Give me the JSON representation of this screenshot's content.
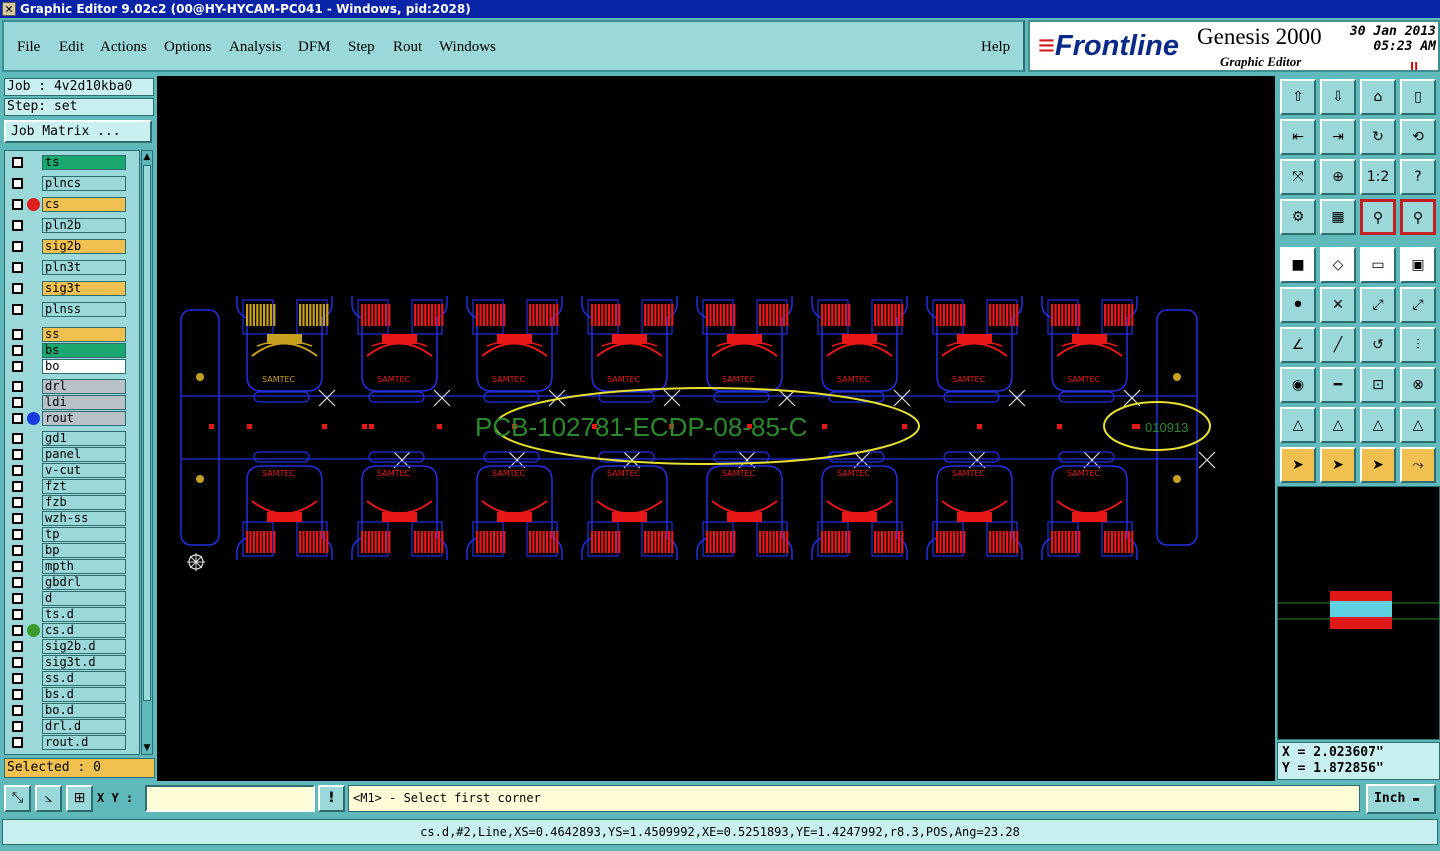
{
  "window": {
    "title": "Graphic Editor 9.02c2 (00@HY-HYCAM-PC041 - Windows, pid:2028)"
  },
  "menu": [
    "File",
    "Edit",
    "Actions",
    "Options",
    "Analysis",
    "DFM",
    "Step",
    "Rout",
    "Windows"
  ],
  "help_label": "Help",
  "brand": {
    "logo": "Frontline",
    "product": "Genesis 2000",
    "subtitle": "Graphic Editor",
    "date": "30 Jan 2013",
    "time": "05:23 AM",
    "pause_glyph": "II"
  },
  "job": {
    "label": "Job : 4v2d10kba0",
    "step": "Step: set",
    "matrix_button": "Job Matrix ..."
  },
  "layers": [
    {
      "name": "ts",
      "color": "#1aa870",
      "dot": ""
    },
    {
      "name": "plncs",
      "color": "#9ad8da",
      "dot": ""
    },
    {
      "name": "cs",
      "color": "#f0c050",
      "dot": "#e02020"
    },
    {
      "name": "pln2b",
      "color": "#9ad8da",
      "dot": ""
    },
    {
      "name": "sig2b",
      "color": "#f0c050",
      "dot": ""
    },
    {
      "name": "pln3t",
      "color": "#9ad8da",
      "dot": ""
    },
    {
      "name": "sig3t",
      "color": "#f0c050",
      "dot": ""
    },
    {
      "name": "plnss",
      "color": "#9ad8da",
      "dot": ""
    },
    {
      "name": "ss",
      "color": "#f0c050",
      "dot": ""
    },
    {
      "name": "bs",
      "color": "#1aa870",
      "dot": ""
    },
    {
      "name": "bo",
      "color": "#ffffff",
      "dot": ""
    },
    {
      "name": "drl",
      "color": "#b8c0c8",
      "dot": ""
    },
    {
      "name": "ldi",
      "color": "#b8c0c8",
      "dot": ""
    },
    {
      "name": "rout",
      "color": "#b8c0c8",
      "dot": "#1a3ae0"
    },
    {
      "name": "gd1",
      "color": "#9ad8da",
      "dot": ""
    },
    {
      "name": "panel",
      "color": "#9ad8da",
      "dot": ""
    },
    {
      "name": "v-cut",
      "color": "#9ad8da",
      "dot": ""
    },
    {
      "name": "fzt",
      "color": "#9ad8da",
      "dot": ""
    },
    {
      "name": "fzb",
      "color": "#9ad8da",
      "dot": ""
    },
    {
      "name": "wzh-ss",
      "color": "#9ad8da",
      "dot": ""
    },
    {
      "name": "tp",
      "color": "#9ad8da",
      "dot": ""
    },
    {
      "name": "bp",
      "color": "#9ad8da",
      "dot": ""
    },
    {
      "name": "mpth",
      "color": "#9ad8da",
      "dot": ""
    },
    {
      "name": "gbdrl",
      "color": "#9ad8da",
      "dot": ""
    },
    {
      "name": "d",
      "color": "#9ad8da",
      "dot": ""
    },
    {
      "name": "ts.d",
      "color": "#9ad8da",
      "dot": ""
    },
    {
      "name": "cs.d",
      "color": "#9ad8da",
      "dot": "#3a9a2a"
    },
    {
      "name": "sig2b.d",
      "color": "#9ad8da",
      "dot": ""
    },
    {
      "name": "sig3t.d",
      "color": "#9ad8da",
      "dot": ""
    },
    {
      "name": "ss.d",
      "color": "#9ad8da",
      "dot": ""
    },
    {
      "name": "bs.d",
      "color": "#9ad8da",
      "dot": ""
    },
    {
      "name": "bo.d",
      "color": "#9ad8da",
      "dot": ""
    },
    {
      "name": "drl.d",
      "color": "#9ad8da",
      "dot": ""
    },
    {
      "name": "rout.d",
      "color": "#9ad8da",
      "dot": ""
    }
  ],
  "selected": "Selected : 0",
  "board": {
    "label_main": "PCB-102781-ECDP-08-85-C",
    "label_date": "010913",
    "component_text": "SAMTEC"
  },
  "coords": {
    "x": "X =  2.023607\"",
    "y": "Y =  1.872856\""
  },
  "bottom": {
    "xy_label": "X Y :",
    "xy_value": "",
    "prompt": "<M1> - Select first corner",
    "units": "Inch"
  },
  "status": "cs.d,#2,Line,XS=0.4642893,YS=1.4509992,XE=0.5251893,YE=1.4247992,r8.3,POS,Ang=23.28",
  "tool_icons": [
    "open-icon",
    "save-icon",
    "home-icon",
    "window-icon",
    "zoom-out-icon",
    "zoom-in-icon",
    "redraw-icon",
    "pan-icon",
    "fit-icon",
    "center-icon",
    "one-to-one-icon",
    "help-icon",
    "measure-icon",
    "grid-icon",
    "snap-icon",
    "snap-red-icon",
    "fill-icon",
    "outline-icon",
    "ruler-icon",
    "dot-icon",
    "connect-icon",
    "cross-icon",
    "pad-icon",
    "pad2-icon",
    "angle-icon",
    "line-icon",
    "arc-icon",
    "flip-icon",
    "select-icon",
    "line2-icon",
    "zoom-box-icon",
    "group-icon",
    "triangle-icon",
    "triangle2-icon",
    "triangle3-icon",
    "triangle4-icon",
    "pointer-icon",
    "pointer-box-icon",
    "pointer-arrow-icon",
    "pointer-net-icon"
  ]
}
